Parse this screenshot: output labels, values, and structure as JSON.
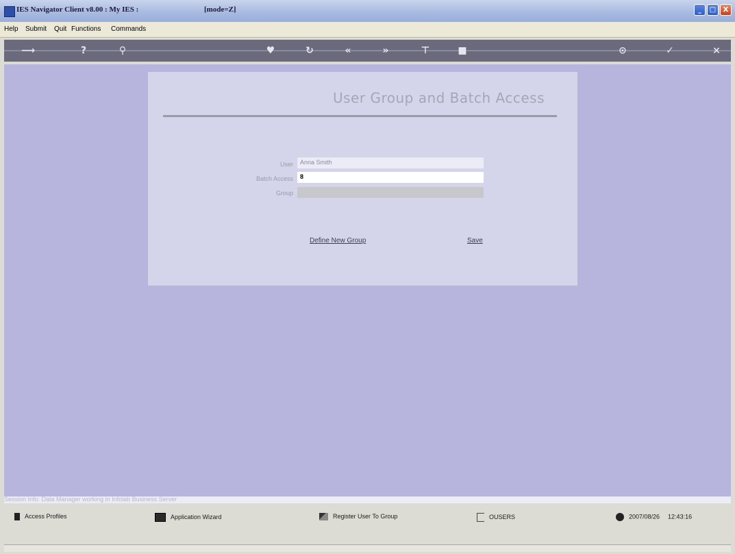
{
  "window": {
    "title": "IES Navigator Client v8.00 : My IES :",
    "mode": "[mode=Z]",
    "controls": {
      "minimize": "_",
      "maximize": "□",
      "close": "X"
    }
  },
  "menu": [
    "Help",
    "Submit",
    "Quit",
    "Functions",
    "Commands"
  ],
  "toolbar": {
    "icons": [
      "back-arrow-icon",
      "help-icon",
      "search-icon",
      "heart-icon",
      "refresh-icon",
      "previous-icon",
      "next-icon",
      "tree-icon",
      "stop-icon",
      "print-icon",
      "ok-icon",
      "close-icon"
    ]
  },
  "form": {
    "title": "User Group and Batch Access",
    "fields": [
      {
        "label": "User",
        "value": "Anna Smith"
      },
      {
        "label": "Batch Access",
        "value": "8"
      },
      {
        "label": "Group",
        "value": ""
      }
    ],
    "links": {
      "define_group": "Define New Group",
      "save": "Save"
    }
  },
  "session_info": "Session Info: Data Manager working in Infolab Business Server",
  "bottom": {
    "access_profiles": "Access Profiles",
    "application_wizard": "Application Wizard",
    "register_user": "Register User To Group",
    "ousers": "OUSERS",
    "date": "2007/08/26",
    "time": "12:43:16"
  },
  "colors": {
    "client_background": "#b7b5de",
    "panel": "#d4d4ea",
    "title_gray": "#a6a6b6"
  }
}
